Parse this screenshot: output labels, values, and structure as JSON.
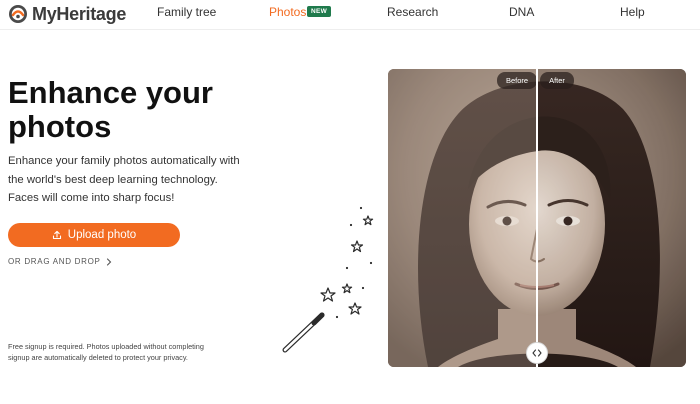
{
  "brand": {
    "name": "MyHeritage",
    "accent": "#f26b21",
    "badge_color": "#1f7a4c"
  },
  "nav": {
    "items": [
      {
        "label": "Family tree",
        "active": false
      },
      {
        "label": "Photos",
        "active": true,
        "badge": "NEW"
      },
      {
        "label": "Research",
        "active": false
      },
      {
        "label": "DNA",
        "active": false
      },
      {
        "label": "Help",
        "active": false
      }
    ]
  },
  "hero": {
    "title_line1": "Enhance your",
    "title_line2": "photos",
    "desc_line1": "Enhance your family photos automatically with",
    "desc_line2": "the world's best deep learning technology.",
    "desc_line3": "Faces will come into sharp focus!",
    "upload_label": "Upload photo",
    "drag_label": "OR DRAG AND DROP",
    "fine_line1": "Free signup is required. Photos uploaded without completing",
    "fine_line2": "signup are automatically deleted to protect your privacy."
  },
  "compare": {
    "before_label": "Before",
    "after_label": "After",
    "slider_position": 0.5
  },
  "icons": {
    "logo": "myheritage-logo-icon",
    "upload": "upload-icon",
    "drag_chevron": "chevron-right-icon",
    "wand": "magic-wand-icon",
    "slider": "compare-slider-icon"
  }
}
